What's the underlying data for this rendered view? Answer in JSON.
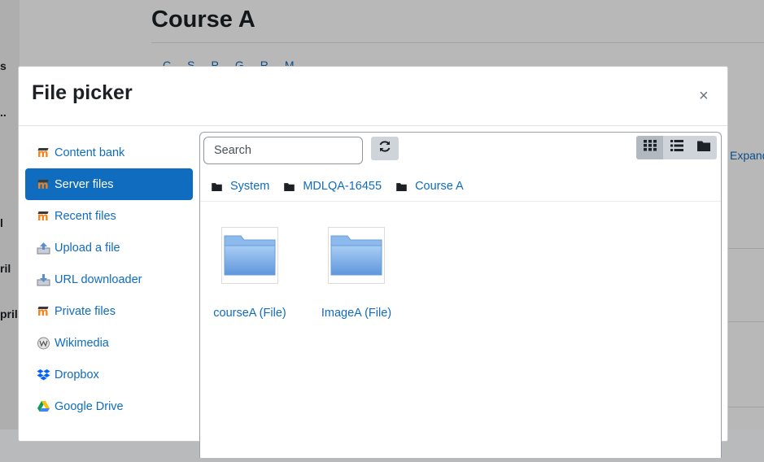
{
  "background": {
    "course_title": "Course A",
    "expand_link": "Expand"
  },
  "modal": {
    "title": "File picker",
    "close_symbol": "×"
  },
  "repositories": [
    {
      "label": "Content bank",
      "icon": "moodle-icon",
      "active": false
    },
    {
      "label": "Server files",
      "icon": "moodle-icon",
      "active": true
    },
    {
      "label": "Recent files",
      "icon": "moodle-icon",
      "active": false
    },
    {
      "label": "Upload a file",
      "icon": "upload-icon",
      "active": false
    },
    {
      "label": "URL downloader",
      "icon": "url-downloader-icon",
      "active": false
    },
    {
      "label": "Private files",
      "icon": "moodle-icon",
      "active": false
    },
    {
      "label": "Wikimedia",
      "icon": "wikimedia-icon",
      "active": false
    },
    {
      "label": "Dropbox",
      "icon": "dropbox-icon",
      "active": false
    },
    {
      "label": "Google Drive",
      "icon": "google-drive-icon",
      "active": false
    }
  ],
  "toolbar": {
    "search_placeholder": "Search",
    "refresh_icon": "refresh-icon",
    "view_modes": [
      {
        "name": "icons",
        "icon": "grid-icon",
        "active": true
      },
      {
        "name": "list",
        "icon": "list-icon",
        "active": false
      },
      {
        "name": "tree",
        "icon": "folder-icon",
        "active": false
      }
    ]
  },
  "breadcrumb": [
    "System",
    "MDLQA-16455",
    "Course A"
  ],
  "files": [
    {
      "name": "courseA (File)",
      "icon": "folder-icon"
    },
    {
      "name": "ImageA (File)",
      "icon": "folder-icon"
    }
  ],
  "colors": {
    "link": "#0f6cbf",
    "active_bg": "#0f6cbf",
    "button_bg": "#ced4da",
    "folder": "#7aaee8"
  }
}
